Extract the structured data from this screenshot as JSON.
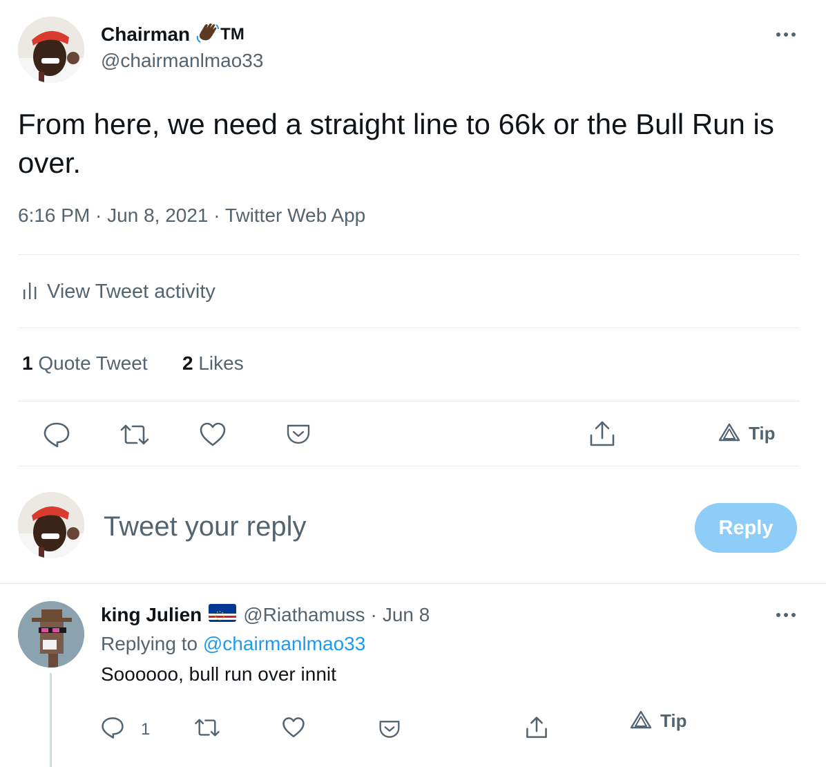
{
  "tweet": {
    "author": {
      "name": "Chairman",
      "badge_text": "TM",
      "handle": "@chairmanlmao33"
    },
    "text": "From here, we need a straight line to 66k or the Bull Run is over.",
    "meta": "6:16 PM · Jun 8, 2021 · Twitter Web App",
    "activity_label": "View Tweet activity",
    "stats": {
      "quote_count": "1",
      "quote_label": "Quote Tweet",
      "likes_count": "2",
      "likes_label": "Likes"
    },
    "actions": {
      "tip_label": "Tip"
    }
  },
  "composer": {
    "placeholder": "Tweet your reply",
    "reply_button": "Reply"
  },
  "reply": {
    "author_name": "king Julien",
    "handle": "@Riathamuss",
    "separator": "·",
    "date": "Jun 8",
    "replying_to_label": "Replying to",
    "replying_to_handle": "@chairmanlmao33",
    "text": "Soooooo, bull run over innit",
    "reply_count": "1",
    "tip_label": "Tip"
  },
  "colors": {
    "accent": "#1d9bf0",
    "reply_button_bg": "#8ecdf8",
    "secondary_text": "#536471",
    "divider": "#e6ecf0"
  }
}
